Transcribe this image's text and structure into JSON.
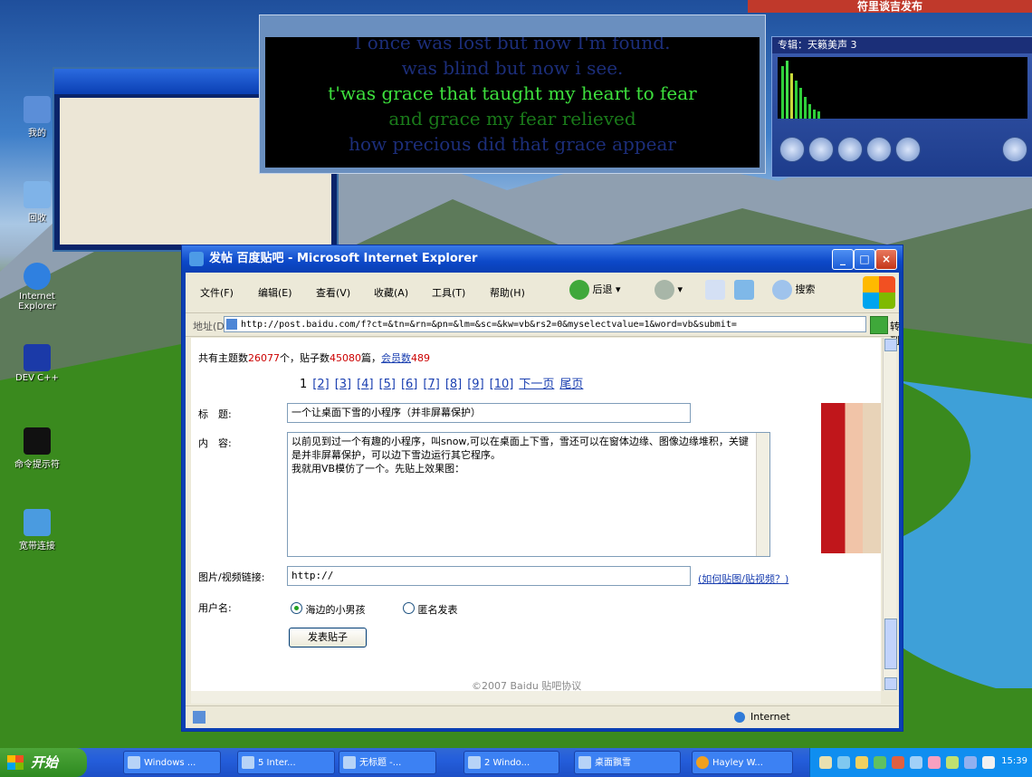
{
  "banner": {
    "text": "符里谈吉发布"
  },
  "desktop_icons": [
    {
      "label": "我的"
    },
    {
      "label": "回收"
    },
    {
      "label": "Internet Explorer"
    },
    {
      "label": "DEV C++"
    },
    {
      "label": "命令提示符"
    },
    {
      "label": "宽带连接"
    }
  ],
  "lyrics": {
    "lines": [
      "I once was lost but now I'm found.",
      "was blind but now i see.",
      "t'was grace that taught my heart to fear",
      "and grace my fear relieved",
      "how precious did that grace appear"
    ]
  },
  "player": {
    "title": "专辑：天籁美声 3"
  },
  "ie": {
    "title": "发帖 百度贴吧 - Microsoft Internet Explorer",
    "menu": [
      "文件(F)",
      "编辑(E)",
      "查看(V)",
      "收藏(A)",
      "工具(T)",
      "帮助(H)"
    ],
    "toolbar": {
      "back": "后退",
      "search": "搜索"
    },
    "address_label": "地址(D)",
    "address": "http://post.baidu.com/f?ct=&tn=&rn=&pn=&lm=&sc=&kw=vb&rs2=0&myselectvalue=1&word=vb&submit=",
    "go_label": "转到",
    "status_zone": "Internet"
  },
  "post": {
    "stats_prefix": "共有主题数",
    "topic_count": "26077",
    "stats_mid": "个，贴子数",
    "post_count": "45080",
    "stats_suffix": "篇，",
    "members_label": "会员数",
    "member_count": "489",
    "pages": [
      "1",
      "[2]",
      "[3]",
      "[4]",
      "[5]",
      "[6]",
      "[7]",
      "[8]",
      "[9]",
      "[10]"
    ],
    "next_page": "下一页",
    "last_page": "尾页",
    "title_label": "标　题:",
    "title_value": "一个让桌面下雪的小程序（并非屏幕保护）",
    "content_label": "内　容:",
    "content_value": "以前见到过一个有趣的小程序，叫snow,可以在桌面上下雪，雪还可以在窗体边缘、图像边缘堆积，关键是并非屏幕保护，可以边下雪边运行其它程序。\n我就用VB模仿了一个。先贴上效果图：",
    "media_label": "图片/视频链接:",
    "media_value": "http://",
    "media_help": "(如何贴图/贴视频？)",
    "user_label": "用户名:",
    "user_option": "海边的小男孩",
    "anon_option": "匿名发表",
    "submit_label": "发表贴子",
    "footer": "©2007 Baidu 贴吧协议"
  },
  "taskbar": {
    "start": "开始",
    "tasks": [
      "Windows ...",
      "5 Inter...",
      "无标题 -...",
      "2 Windo...",
      "桌面飘雪",
      "Hayley W..."
    ],
    "clock": "15:39"
  }
}
